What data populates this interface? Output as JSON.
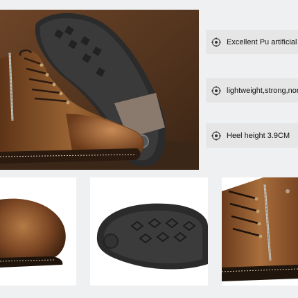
{
  "features": [
    {
      "text": "Excellent Pu artificial",
      "icon": "bullet-target-icon"
    },
    {
      "text": "lightweight,strong,non-s",
      "icon": "bullet-target-icon"
    },
    {
      "text": "Heel height 3.9CM",
      "icon": "bullet-target-icon"
    }
  ],
  "colors": {
    "leather": "#7a4a2a",
    "leather_light": "#a8703f",
    "sole": "#2e2e2e",
    "backdrop": "#5b3a22",
    "feature_bg": "#e6e6e6"
  }
}
